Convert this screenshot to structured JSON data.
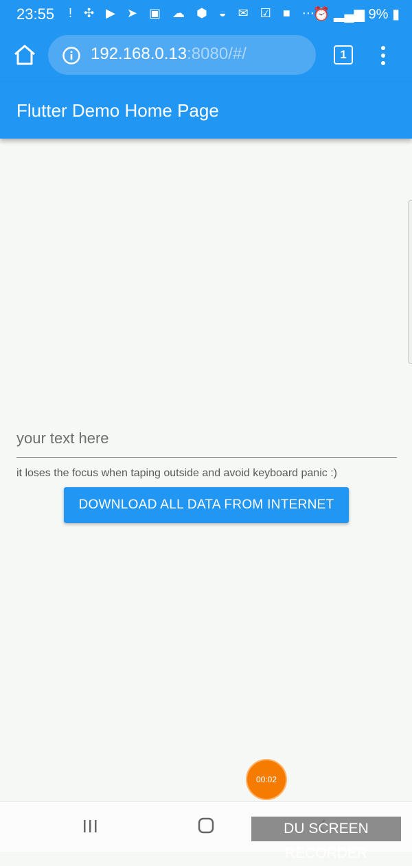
{
  "status_bar": {
    "time": "23:55",
    "battery": "9%",
    "icons": [
      "alert-icon",
      "apps-icon",
      "youtube-icon",
      "telegram-icon",
      "translate-icon",
      "wifi-cloud-icon",
      "shield-icon",
      "bowl-icon",
      "mail-icon",
      "check-icon",
      "video-icon",
      "more-icon",
      "alarm-icon",
      "mute-icon",
      "wifi-icon",
      "signal-icon",
      "battery-icon"
    ]
  },
  "browser": {
    "url_host": "192.168.0.13",
    "url_rest": ":8080/#/",
    "tab_count": "1"
  },
  "app": {
    "title": "Flutter Demo Home Page"
  },
  "form": {
    "input_placeholder": "your text here",
    "input_value": "",
    "helper_text": "it loses the focus when taping outside and avoid keyboard panic :)",
    "button_label": "DOWNLOAD ALL DATA FROM INTERNET"
  },
  "recorder": {
    "timer": "00:02",
    "watermark": "DU SCREEN RECORDER"
  },
  "colors": {
    "primary": "#2196f3",
    "background": "#f5f8f4",
    "recorder": "#f57c00"
  }
}
